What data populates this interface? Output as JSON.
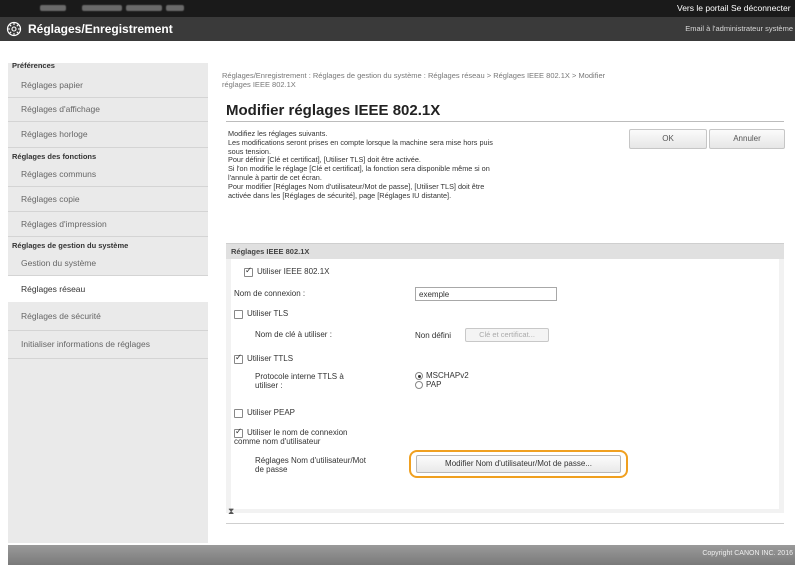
{
  "topbar": {
    "portal_link": "Vers le portail",
    "logout_link": "Se déconnecter"
  },
  "header": {
    "title": "Réglages/Enregistrement",
    "admin_email": "Email à l'administrateur système",
    "logo_icon": "gear-icon"
  },
  "sidebar": {
    "groups": [
      {
        "heading": "Préférences",
        "items": [
          "Réglages papier",
          "Réglages d'affichage",
          "Réglages horloge"
        ]
      },
      {
        "heading": "Réglages des fonctions",
        "items": [
          "Réglages communs",
          "Réglages copie",
          "Réglages d'impression"
        ]
      },
      {
        "heading": "Réglages de gestion du système",
        "items": [
          "Gestion du système",
          "Réglages réseau",
          "Réglages de sécurité",
          "Initialiser informations de réglages"
        ]
      }
    ],
    "active_item": "Réglages réseau"
  },
  "main": {
    "breadcrumb_line1": "Réglages/Enregistrement : Réglages de gestion du système : Réglages réseau > Réglages IEEE 802.1X > Modifier",
    "breadcrumb_line2": "réglages IEEE 802.1X",
    "title": "Modifier réglages IEEE 802.1X",
    "description": [
      "Modifiez les réglages suivants.",
      "Les modifications seront prises en compte lorsque la machine sera mise hors puis",
      "sous tension.",
      "Pour définir [Clé et certificat], [Utiliser TLS] doit être activée.",
      "Si l'on modifie le réglage [Clé et certificat], la fonction sera disponible même si on",
      "l'annule à partir de cet écran.",
      "Pour modifier [Réglages Nom d'utilisateur/Mot de passe], [Utiliser TLS] doit être",
      "activée dans les [Réglages de sécurité], page [Réglages IU distante]."
    ],
    "ok_label": "OK",
    "cancel_label": "Annuler",
    "section": {
      "heading": "Réglages IEEE 802.1X",
      "use_ieee_label": "Utiliser IEEE 802.1X",
      "use_ieee_checked": true,
      "login_name_label": "Nom de connexion :",
      "login_name_value": "exemple",
      "use_tls_label": "Utiliser TLS",
      "use_tls_checked": false,
      "key_name_label": "Nom de clé à utiliser :",
      "key_name_value": "Non défini",
      "key_cert_button": "Clé et certificat...",
      "use_ttls_label": "Utiliser TTLS",
      "use_ttls_checked": true,
      "ttls_protocol_label_line1": "Protocole interne TTLS à",
      "ttls_protocol_label_line2": "utiliser :",
      "ttls_options": [
        "MSCHAPv2",
        "PAP"
      ],
      "ttls_selected": "MSCHAPv2",
      "use_peap_label": "Utiliser PEAP",
      "use_peap_checked": false,
      "use_login_as_user_line1": "Utiliser le nom de connexion",
      "use_login_as_user_line2": "comme nom d'utilisateur",
      "use_login_as_user_checked": true,
      "user_pass_label_line1": "Réglages Nom d'utilisateur/Mot",
      "user_pass_label_line2": "de passe",
      "modify_user_pass_button": "Modifier Nom d'utilisateur/Mot de passe..."
    },
    "top_anchor": "⧗"
  },
  "footer": {
    "copyright": "Copyright CANON INC. 2016"
  },
  "colors": {
    "topbar": "#1a1a1a",
    "header": "#3a3a3a",
    "sidebar": "#eaeaea",
    "highlight": "#f0a020"
  }
}
